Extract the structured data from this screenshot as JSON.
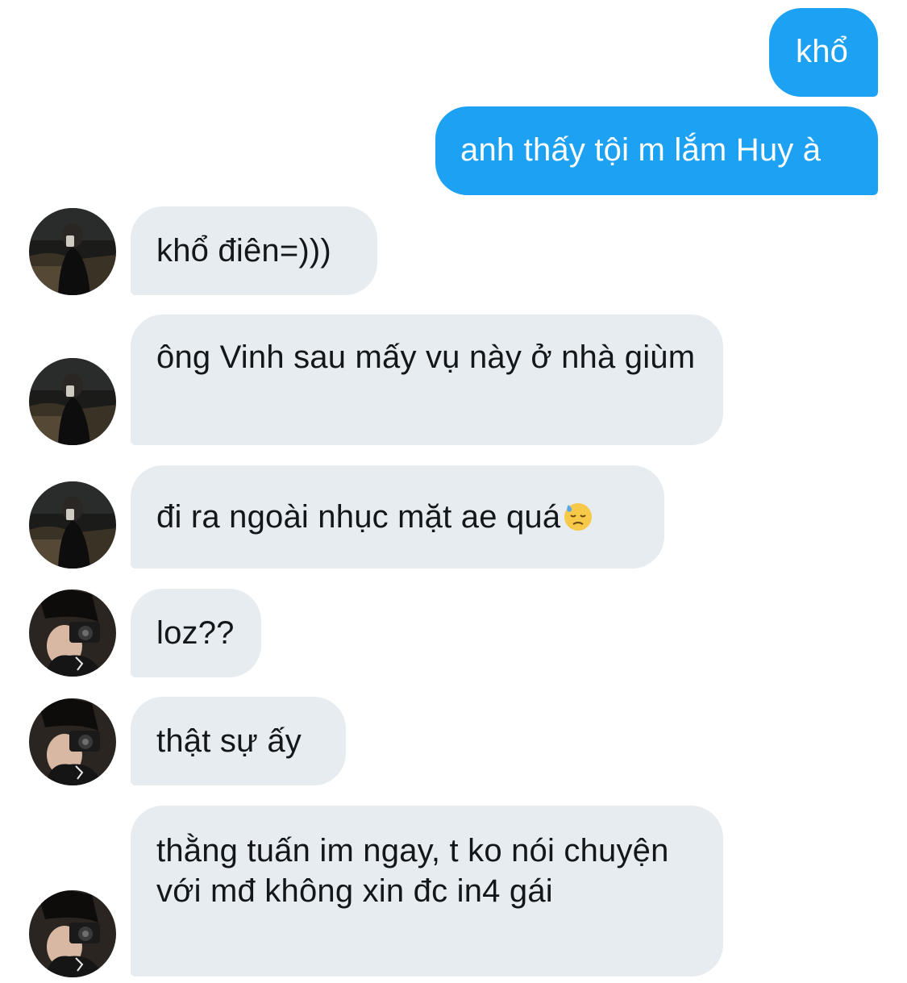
{
  "messages": [
    {
      "direction": "outgoing",
      "text": "khổ"
    },
    {
      "direction": "outgoing",
      "text": "anh thấy tội m lắm Huy à"
    },
    {
      "direction": "incoming",
      "avatar": "avatar-dark-hoodie",
      "text": "khổ điên=)))"
    },
    {
      "direction": "incoming",
      "avatar": "avatar-dark-hoodie",
      "text": "ông Vinh sau mấy vụ này ở nhà giùm"
    },
    {
      "direction": "incoming",
      "avatar": "avatar-dark-hoodie",
      "text": "đi ra ngoài nhục mặt ae quá",
      "emoji": "downcast-face-with-sweat-emoji"
    },
    {
      "direction": "incoming",
      "avatar": "avatar-camera",
      "text": "loz??"
    },
    {
      "direction": "incoming",
      "avatar": "avatar-camera",
      "text": "thật sự ấy"
    },
    {
      "direction": "incoming",
      "avatar": "avatar-camera",
      "text": "thằng tuấn im ngay, t ko nói chuyện với mđ không xin đc in4 gái"
    }
  ],
  "colors": {
    "outgoing_bubble": "#1da1f2",
    "incoming_bubble": "#e6ecf0",
    "incoming_text": "#14171a",
    "outgoing_text": "#ffffff"
  }
}
